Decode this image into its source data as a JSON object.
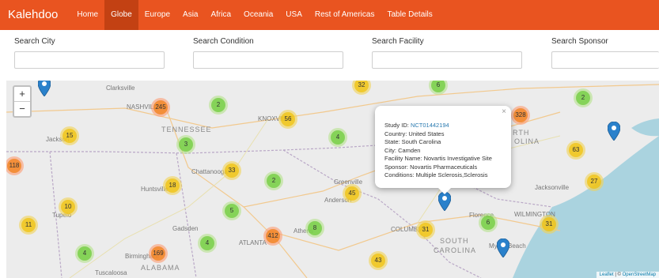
{
  "navbar": {
    "brand": "Kalehdoo",
    "items": [
      "Home",
      "Globe",
      "Europe",
      "Asia",
      "Africa",
      "Oceania",
      "USA",
      "Rest of Americas",
      "Table Details"
    ],
    "active": "Globe"
  },
  "search": {
    "city": "Search City",
    "condition": "Search Condition",
    "facility": "Search Facility",
    "sponsor": "Search Sponsor"
  },
  "map": {
    "zoom_in": "+",
    "zoom_out": "−",
    "cities": [
      "Clarksville",
      "NASHVILLE",
      "Jackson",
      "KNOXVILLE",
      "Chattanooga",
      "Huntsville",
      "Tupelo",
      "Gadsden",
      "Birmingham",
      "Tuscaloosa",
      "ATLANTA",
      "Athens",
      "Greenville",
      "Anderson",
      "COLUMBIA",
      "Florence",
      "Myrtle Beach",
      "WILMINGTON",
      "Jacksonville",
      "NORTH CAROLINA"
    ],
    "states": [
      "TENNESSEE",
      "ALABAMA",
      "SOUTH",
      "CAROLINA",
      "RTH",
      "OLINA"
    ],
    "clusters": [
      {
        "count": "245",
        "color": "orange"
      },
      {
        "count": "2",
        "color": "green"
      },
      {
        "count": "56",
        "color": "yellow"
      },
      {
        "count": "15",
        "color": "yellow"
      },
      {
        "count": "3",
        "color": "green"
      },
      {
        "count": "4",
        "color": "green"
      },
      {
        "count": "118",
        "color": "orange"
      },
      {
        "count": "33",
        "color": "yellow"
      },
      {
        "count": "18",
        "color": "yellow"
      },
      {
        "count": "2",
        "color": "green"
      },
      {
        "count": "45",
        "color": "yellow"
      },
      {
        "count": "10",
        "color": "yellow"
      },
      {
        "count": "5",
        "color": "green"
      },
      {
        "count": "11",
        "color": "yellow"
      },
      {
        "count": "412",
        "color": "orange"
      },
      {
        "count": "8",
        "color": "green"
      },
      {
        "count": "4",
        "color": "green"
      },
      {
        "count": "169",
        "color": "orange"
      },
      {
        "count": "4",
        "color": "green"
      },
      {
        "count": "31",
        "color": "yellow"
      },
      {
        "count": "6",
        "color": "green"
      },
      {
        "count": "31",
        "color": "yellow"
      },
      {
        "count": "43",
        "color": "yellow"
      },
      {
        "count": "32",
        "color": "yellow"
      },
      {
        "count": "6",
        "color": "green"
      },
      {
        "count": "328",
        "color": "orange"
      },
      {
        "count": "2",
        "color": "green"
      },
      {
        "count": "63",
        "color": "yellow"
      },
      {
        "count": "27",
        "color": "yellow"
      }
    ],
    "popup": {
      "close": "×",
      "study_label": "Study ID: ",
      "study_id": "NCT01442194",
      "country": "Country: United States",
      "state": "State: South Carolina",
      "city": "City: Camden",
      "facility": "Facility Name: Novartis Investigative Site",
      "sponsor": "Sponsor: Novartis Pharmaceuticals",
      "conditions": "Conditions: Multiple Sclerosis,Sclerosis"
    },
    "attribution_leaflet": "Leaflet",
    "attribution_sep": " | © ",
    "attribution_osm": "OpenStreetMap"
  },
  "colors": {
    "navbar": "#e95420",
    "navbar_active": "#c34113",
    "marker": "#2a81cb"
  }
}
